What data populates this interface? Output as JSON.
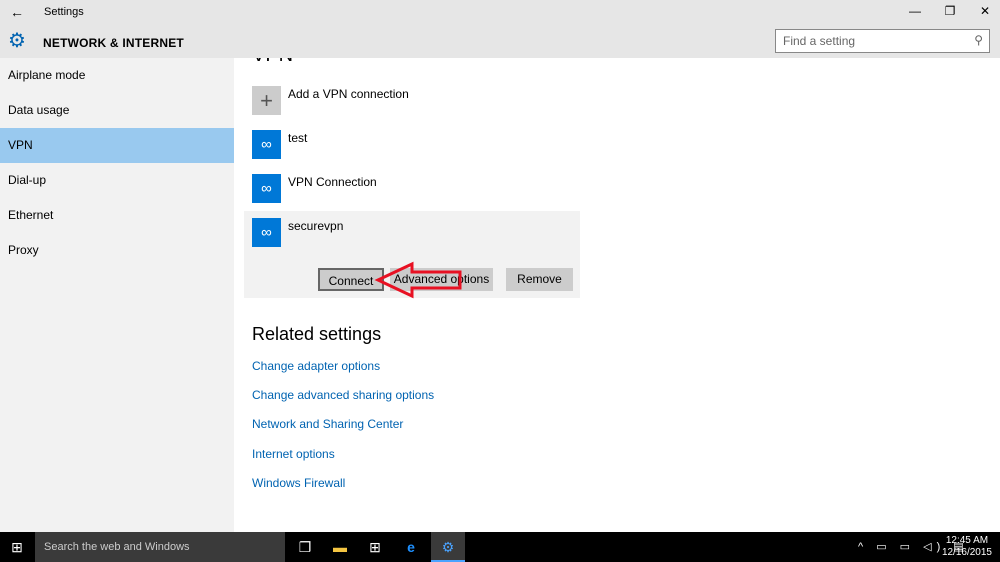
{
  "window": {
    "title": "Settings",
    "section": "NETWORK & INTERNET",
    "search_placeholder": "Find a setting",
    "minimize": "—",
    "restore": "❐",
    "close": "✕"
  },
  "sidebar": {
    "items": [
      {
        "label": "Airplane mode"
      },
      {
        "label": "Data usage"
      },
      {
        "label": "VPN",
        "selected": true
      },
      {
        "label": "Dial-up"
      },
      {
        "label": "Ethernet"
      },
      {
        "label": "Proxy"
      }
    ]
  },
  "main": {
    "title": "VPN",
    "add_label": "Add a VPN connection",
    "connections": [
      {
        "name": "test"
      },
      {
        "name": "VPN Connection"
      },
      {
        "name": "securevpn",
        "selected": true
      }
    ],
    "buttons": {
      "connect": "Connect",
      "advanced": "Advanced options",
      "remove": "Remove"
    },
    "related_title": "Related settings",
    "links": [
      "Change adapter options",
      "Change advanced sharing options",
      "Network and Sharing Center",
      "Internet options",
      "Windows Firewall"
    ]
  },
  "annotation": {
    "type": "red-arrow",
    "points_to": "Connect",
    "color": "#e81123"
  },
  "taskbar": {
    "search_placeholder": "Search the web and Windows",
    "time": "12:45 AM",
    "date": "12/16/2015"
  },
  "colors": {
    "accent": "#0078d7",
    "selected": "#99c9ef",
    "link": "#0063b1"
  }
}
